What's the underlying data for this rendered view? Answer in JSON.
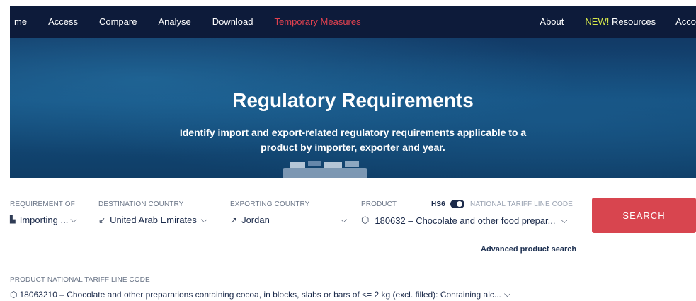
{
  "nav": {
    "home": "me",
    "access": "Access",
    "compare": "Compare",
    "analyse": "Analyse",
    "download": "Download",
    "temporary_measures": "Temporary Measures",
    "about": "About",
    "new_badge": "NEW!",
    "resources": " Resources",
    "account": "Acco"
  },
  "hero": {
    "title": "Regulatory Requirements",
    "subtitle": "Identify import and export-related regulatory requirements applicable to a product by importer, exporter and year."
  },
  "search": {
    "requirement_of": {
      "label": "REQUIREMENT OF",
      "value": "Importing ..."
    },
    "destination_country": {
      "label": "DESTINATION COUNTRY",
      "value": "United Arab Emirates"
    },
    "exporting_country": {
      "label": "EXPORTING COUNTRY",
      "value": "Jordan"
    },
    "product": {
      "label": "PRODUCT",
      "value": "180632 – Chocolate and other food prepar..."
    },
    "hs6_label": "HS6",
    "national_tariff_label": "NATIONAL TARIFF LINE CODE",
    "search_button": "SEARCH",
    "advanced_link": "Advanced product search",
    "product_national_tariff": {
      "label": "PRODUCT NATIONAL TARIFF LINE CODE",
      "value": "18063210 – Chocolate and other preparations containing cocoa, in blocks, slabs or bars of <= 2 kg (excl. filled): Containing alc..."
    }
  },
  "colors": {
    "nav_bg": "#0d1b3a",
    "accent_red": "#d8454f",
    "temp_measures": "#e0414f",
    "new_badge": "#d6e84a"
  }
}
